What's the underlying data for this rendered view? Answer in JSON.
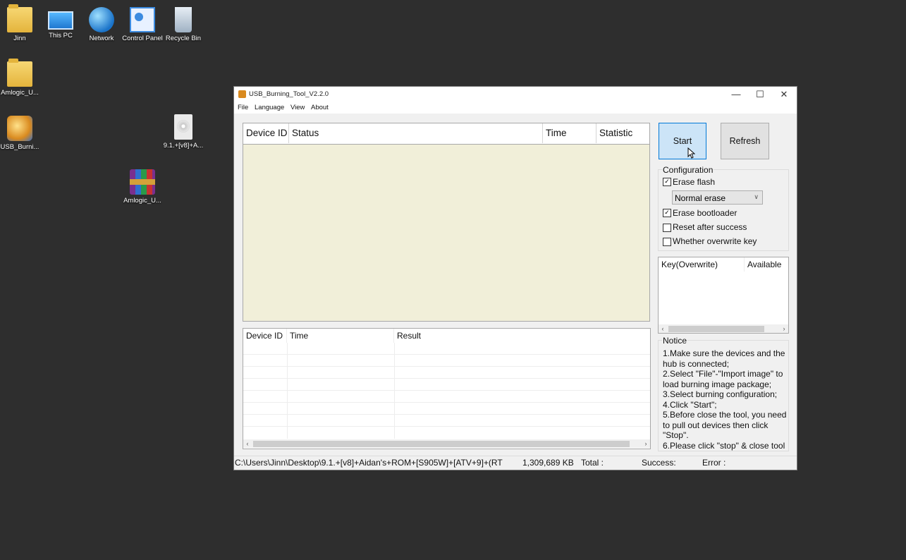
{
  "desktop": {
    "icons": [
      {
        "label": "Jinn",
        "icon": "user-folder-icon"
      },
      {
        "label": "This PC",
        "icon": "computer-icon"
      },
      {
        "label": "Network",
        "icon": "network-icon"
      },
      {
        "label": "Control Panel",
        "icon": "control-panel-icon"
      },
      {
        "label": "Recycle Bin",
        "icon": "recycle-bin-icon"
      },
      {
        "label": "Amlogic_U...",
        "icon": "folder-icon"
      },
      {
        "label": "USB_Burni...",
        "icon": "usb-burning-tool-icon"
      },
      {
        "label": "9.1.+[v8]+A...",
        "icon": "disc-image-icon"
      },
      {
        "label": "Amlogic_U...",
        "icon": "winrar-archive-icon"
      }
    ]
  },
  "window": {
    "title": "USB_Burning_Tool_V2.2.0",
    "controls": {
      "minimize": "—",
      "maximize": "☐",
      "close": "✕"
    },
    "menu": [
      "File",
      "Language",
      "View",
      "About"
    ],
    "device_table": {
      "headers": [
        "Device ID",
        "Status",
        "Time",
        "Statistic"
      ],
      "bg_color": "#f1efd9"
    },
    "result_table": {
      "headers": [
        "Device ID",
        "Time",
        "Result"
      ]
    },
    "buttons": {
      "start": "Start",
      "refresh": "Refresh"
    },
    "configuration": {
      "title": "Configuration",
      "erase_flash": {
        "label": "Erase flash",
        "checked": true
      },
      "erase_mode": "Normal erase",
      "erase_bootloader": {
        "label": "Erase bootloader",
        "checked": true
      },
      "reset_after_success": {
        "label": "Reset after success",
        "checked": false
      },
      "overwrite_key": {
        "label": "Whether overwrite key",
        "checked": false
      }
    },
    "key_table": {
      "headers": [
        "Key(Overwrite)",
        "Available"
      ]
    },
    "notice": {
      "title": "Notice",
      "lines": [
        "1.Make sure the devices and the",
        "hub is connected;",
        "2.Select \"File\"-\"Import image\" to",
        "load burning image package;",
        "3.Select burning configuration;",
        "4.Click \"Start\";",
        "5.Before close the tool, you need",
        "to pull out devices then click",
        "\"Stop\".",
        "6.Please click \"stop\" & close tool"
      ]
    },
    "status_bar": {
      "path": "C:\\Users\\Jinn\\Desktop\\9.1.+[v8]+Aidan's+ROM+[S905W]+[ATV+9]+(RT",
      "size": "1,309,689 KB",
      "total": "Total :",
      "success": "Success:",
      "error": "Error :"
    }
  }
}
